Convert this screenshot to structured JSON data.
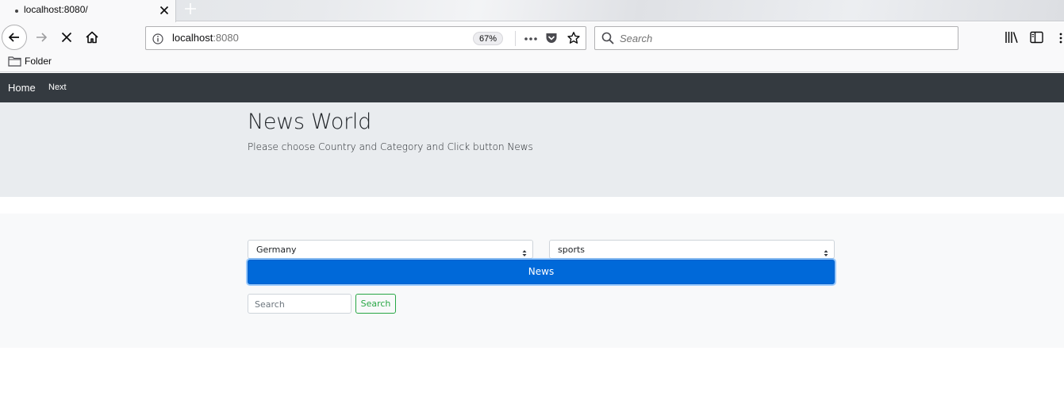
{
  "browser": {
    "tab_title": "localhost:8080/",
    "url_host": "localhost",
    "url_port": ":8080",
    "zoom": "67%",
    "search_placeholder": "Search",
    "bookmark_folder": "Folder"
  },
  "page": {
    "nav": {
      "home": "Home",
      "next": "Next"
    },
    "jumbotron": {
      "title": "News World",
      "subtitle": "Please choose Country and Category and Click button News"
    },
    "form": {
      "country": "Germany",
      "category": "sports",
      "news_button": "News",
      "search_placeholder": "Search",
      "search_button": "Search"
    }
  },
  "colors": {
    "navbar": "#343a40",
    "jumbotron": "#e9ecef",
    "primary": "#0069d9",
    "success": "#28a745"
  }
}
